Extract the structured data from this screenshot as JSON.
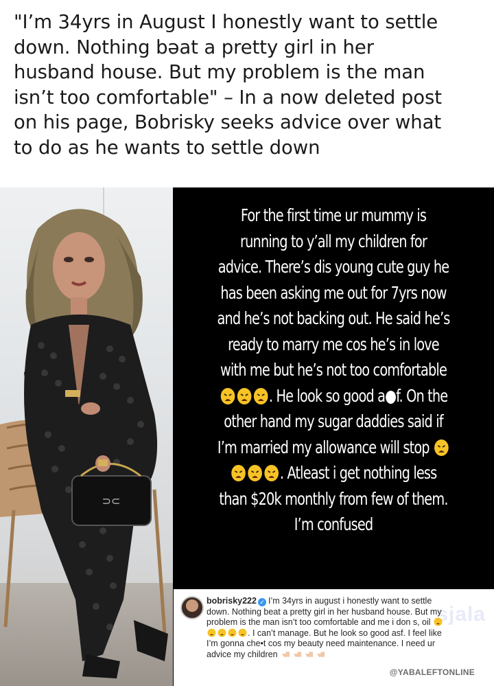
{
  "headline": {
    "line1": "\"I’m 34yrs in August I honestly want to settle",
    "line2": "down. Nothing bəat a pretty girl in her",
    "line3": "husband house. But my problem is the man",
    "line4": "isn’t too comfortable\" – In a now deleted post",
    "line5": "on his page, Bobrisky seeks advice over what",
    "line6": "to do as he wants to settle down"
  },
  "story": {
    "l1": "For the first time ur mummy is",
    "l2": "running to y’all my children for",
    "l3": "advice. There’s dis young cute guy he",
    "l4": "has been asking me out for 7yrs now",
    "l5": "and he’s not backing out. He said he’s",
    "l6": "ready to marry me cos he’s in love",
    "l7": "with me but he’s not too comfortable",
    "l8_text": ". He look so good a●f. On the",
    "l9": "other hand my sugar daddies said if",
    "l10_text": "I’m married my allowance will stop",
    "l11_text": ". Atleast i get nothing less",
    "l12": "than $20k monthly from few of them.",
    "l13": "I’m confused"
  },
  "instagram_caption": {
    "username": "bobrisky222",
    "verified_glyph": "✓",
    "c1": "I’m 34yrs in august i honestly want to settle",
    "c2": "down. Nothing beat a pretty girl in her husband house. But my",
    "c3": "problem is the man isn’t too comfortable and me i don s, oil",
    "c4": ". I can’t manage. But he look so good asf. I feel like",
    "c5": "I’m gonna che•t cos my beauty need maintenance. I need ur",
    "c6": "advice my children",
    "watermark": "@YABALEFTONLINE",
    "faint_mark": "sjala"
  },
  "icons": {
    "weary_face": "weary-face-emoji",
    "pointing_hand": "pointing-left-hand-emoji",
    "verified": "verified-badge-icon"
  },
  "colors": {
    "story_bg": "#000000",
    "story_text": "#ffffff",
    "headline_text": "#1a1a1a",
    "verified_blue": "#3897f0",
    "emoji_yellow": "#f7c325"
  }
}
